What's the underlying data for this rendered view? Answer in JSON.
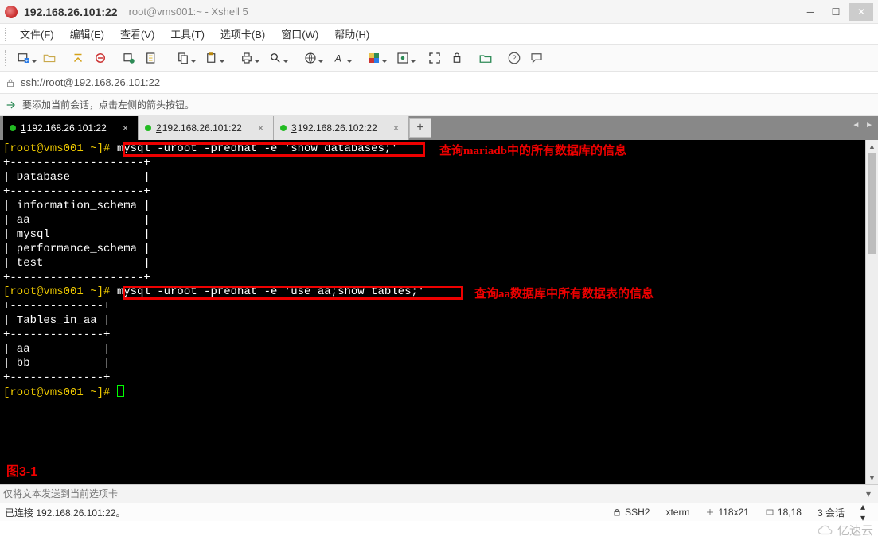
{
  "titlebar": {
    "ip": "192.168.26.101:22",
    "subtitle": "root@vms001:~ - Xshell 5"
  },
  "menu": {
    "file": "文件(F)",
    "edit": "编辑(E)",
    "view": "查看(V)",
    "tools": "工具(T)",
    "tabs": "选项卡(B)",
    "window": "窗口(W)",
    "help": "帮助(H)"
  },
  "address": {
    "url": "ssh://root@192.168.26.101:22"
  },
  "infobar": {
    "text": "要添加当前会话，点击左侧的箭头按钮。"
  },
  "tabs": {
    "items": [
      {
        "num": "1",
        "label": " 192.168.26.101:22"
      },
      {
        "num": "2",
        "label": " 192.168.26.101:22"
      },
      {
        "num": "3",
        "label": " 192.168.26.102:22"
      }
    ],
    "add": "+"
  },
  "terminal": {
    "prompt1_user": "[root@vms001 ~]#",
    "cmd1": "mysql -uroot -predhat -e 'show databases;'",
    "sep_long": "+--------------------+",
    "db_header": "| Database           |",
    "db_rows": [
      "| information_schema |",
      "| aa                 |",
      "| mysql              |",
      "| performance_schema |",
      "| test               |"
    ],
    "prompt2_user": "[root@vms001 ~]#",
    "cmd2": "mysql -uroot -predhat -e 'use aa;show tables;'",
    "sep_short": "+--------------+",
    "tb_header": "| Tables_in_aa |",
    "tb_rows": [
      "| aa           |",
      "| bb           |"
    ],
    "prompt3_user": "[root@vms001 ~]#"
  },
  "annotations": {
    "a1": "查询mariadb中的所有数据库的信息",
    "a2": "查询aa数据库中所有数据表的信息",
    "fig": "图3-1"
  },
  "sendbar": {
    "placeholder": "仅将文本发送到当前选项卡"
  },
  "status": {
    "conn": "已连接 192.168.26.101:22。",
    "proto": "SSH2",
    "term": "xterm",
    "size": "118x21",
    "pos": "18,18",
    "sessions": "3 会话"
  },
  "watermark": {
    "text": "亿速云"
  }
}
